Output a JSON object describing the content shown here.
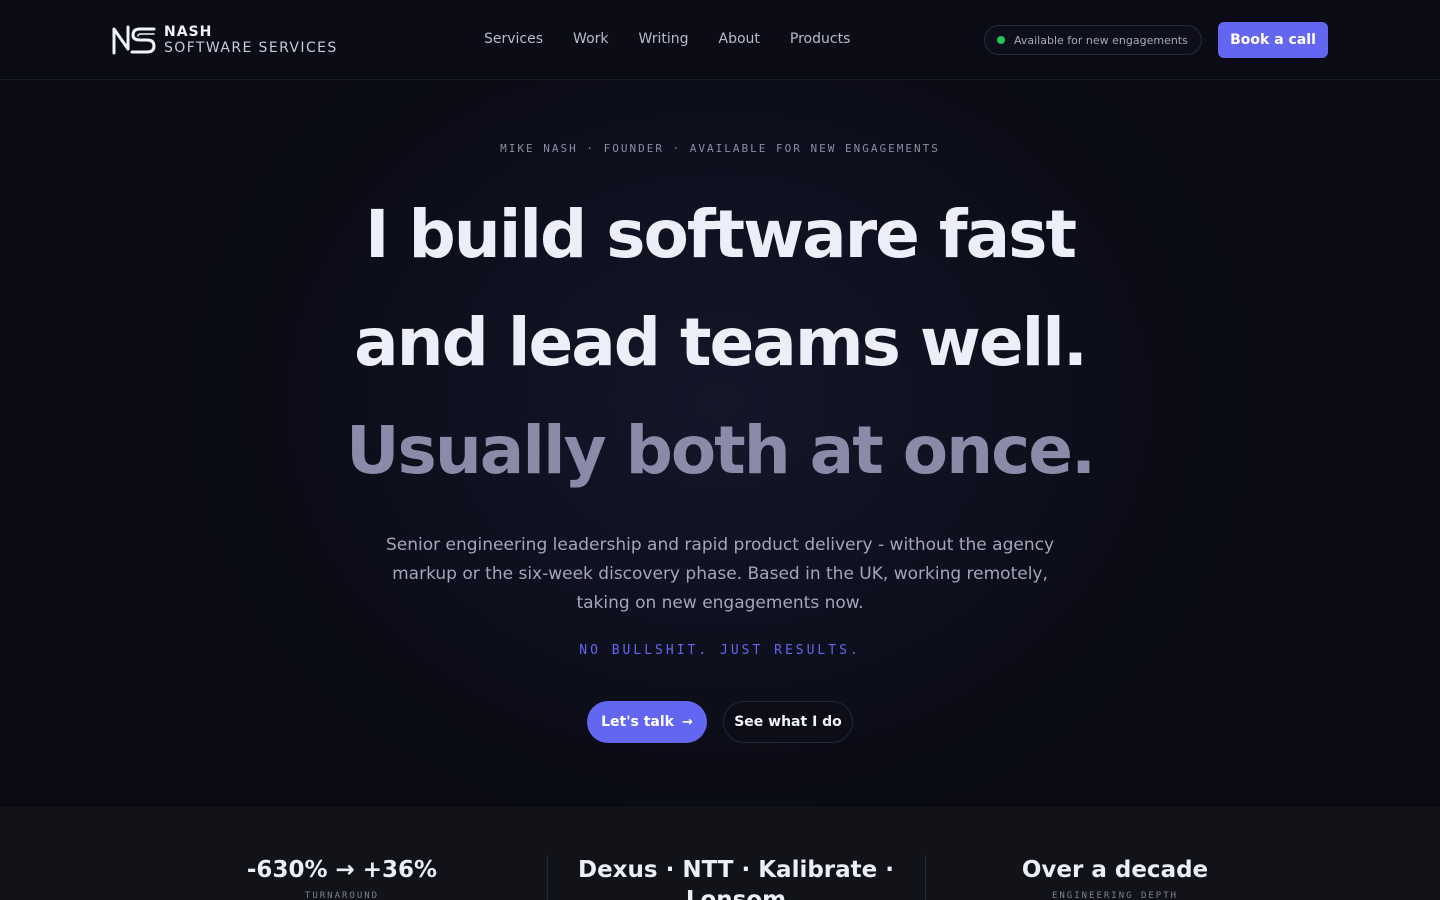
{
  "brand": {
    "name": "NASH",
    "subtitle": "SOFTWARE SERVICES"
  },
  "nav": {
    "links": [
      "Services",
      "Work",
      "Writing",
      "About",
      "Products"
    ],
    "status": "Available for new engagements",
    "cta": "Book a call"
  },
  "hero": {
    "eyebrow": "MIKE NASH · FOUNDER · AVAILABLE FOR NEW ENGAGEMENTS",
    "headline_line1": "I build software fast",
    "headline_line2": "and lead teams well.",
    "headline_line3": "Usually both at once.",
    "subcopy": "Senior engineering leadership and rapid product delivery - without the agency markup or the six-week discovery phase. Based in the UK, working remotely, taking on new engagements now.",
    "tagline": "NO BULLSHIT. JUST RESULTS.",
    "cta_primary": "Let's talk",
    "cta_primary_arrow": "→",
    "cta_secondary": "See what I do"
  },
  "stats": [
    {
      "value": "-630% → +36%",
      "label": "TURNAROUND"
    },
    {
      "value": "Dexus · NTT · Kalibrate · Lonsom",
      "label": ""
    },
    {
      "value": "Over a decade",
      "label": "ENGINEERING DEPTH"
    }
  ],
  "colors": {
    "accent": "#6366f1",
    "status_green": "#22c55e",
    "background": "#0a0b14"
  }
}
